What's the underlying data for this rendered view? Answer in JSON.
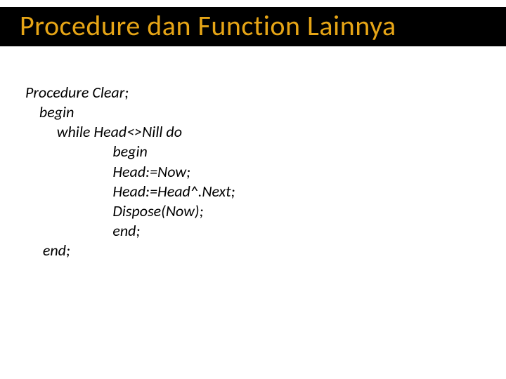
{
  "slide": {
    "title": "Procedure dan Function Lainnya",
    "code": {
      "l1": "Procedure Clear;",
      "l2": "    begin",
      "l3": "         while Head<>Nill do",
      "l4": "                         begin",
      "l5": "                         Head:=Now;",
      "l6": "                         Head:=Head^.Next;",
      "l7": "                         Dispose(Now);",
      "l8": "                         end;",
      "l9": "     end;"
    }
  }
}
